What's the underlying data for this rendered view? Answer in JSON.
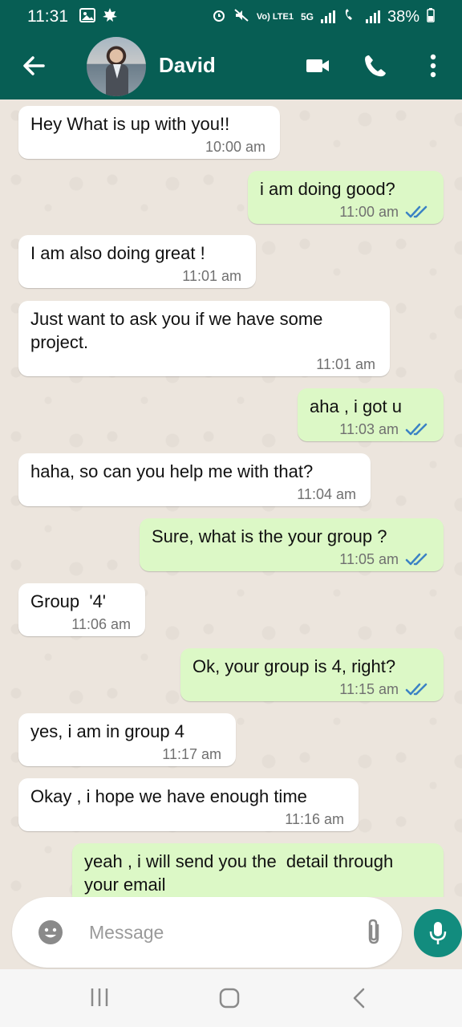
{
  "status_bar": {
    "time": "11:31",
    "volte_label": "Vo) LTE1",
    "network": "5G",
    "battery": "38%"
  },
  "header": {
    "contact_name": "David",
    "icons": [
      "back-arrow-icon",
      "video-call-icon",
      "voice-call-icon",
      "more-options-icon"
    ]
  },
  "messages": [
    {
      "dir": "in",
      "text": "Hey What is up with you!!",
      "time": "10:00 am"
    },
    {
      "dir": "out",
      "text": "i am doing good?",
      "time": "11:00 am",
      "status": "read"
    },
    {
      "dir": "in",
      "text": "I am also doing great !",
      "time": "11:01 am"
    },
    {
      "dir": "in",
      "text": "Just want to ask you if we have some project.",
      "time": "11:01 am"
    },
    {
      "dir": "out",
      "text": "aha , i got u",
      "time": "11:03 am",
      "status": "read"
    },
    {
      "dir": "in",
      "text": "haha, so can you help me with that?",
      "time": "11:04 am"
    },
    {
      "dir": "out",
      "text": "Sure, what is the your group ?",
      "time": "11:05 am",
      "status": "read"
    },
    {
      "dir": "in",
      "text": "Group  '4'",
      "time": "11:06 am"
    },
    {
      "dir": "out",
      "text": "Ok, your group is 4, right?",
      "time": "11:15 am",
      "status": "read"
    },
    {
      "dir": "in",
      "text": "yes, i am in group 4",
      "time": "11:17 am"
    },
    {
      "dir": "in",
      "text": "Okay , i hope we have enough time",
      "time": "11:16 am"
    },
    {
      "dir": "out",
      "text": "yeah , i will send you the  detail through  your email",
      "time": ""
    }
  ],
  "composer": {
    "placeholder": "Message"
  },
  "colors": {
    "header": "#075e54",
    "incoming": "#ffffff",
    "outgoing": "#dcf8c6",
    "mic": "#128c7e",
    "read_ticks": "#3b82c4"
  }
}
